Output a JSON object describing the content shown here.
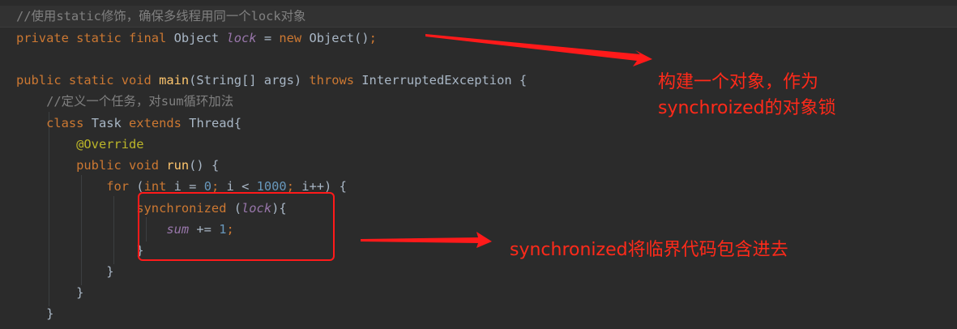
{
  "editor": {
    "lines": [
      {
        "id": "comment-static",
        "tokens": [
          {
            "text": "//使用static修饰，确保多线程用同一个lock对象",
            "kind": "cmt"
          }
        ]
      },
      {
        "id": "lock-declaration",
        "tokens": [
          {
            "text": "private static final ",
            "kind": "kw"
          },
          {
            "text": "Object ",
            "kind": "plain"
          },
          {
            "text": "lock",
            "kind": "field"
          },
          {
            "text": " = ",
            "kind": "plain"
          },
          {
            "text": "new ",
            "kind": "kw"
          },
          {
            "text": "Object()",
            "kind": "plain"
          },
          {
            "text": ";",
            "kind": "kw"
          }
        ]
      },
      {
        "id": "blank-line",
        "tokens": []
      },
      {
        "id": "main-signature",
        "tokens": [
          {
            "text": "public static void ",
            "kind": "kw"
          },
          {
            "text": "main",
            "kind": "fn"
          },
          {
            "text": "(String[] args) ",
            "kind": "plain"
          },
          {
            "text": "throws ",
            "kind": "kw"
          },
          {
            "text": "InterruptedException {",
            "kind": "plain"
          }
        ]
      },
      {
        "id": "comment-task",
        "tokens": [
          {
            "text": "    //定义一个任务，对sum循环加法",
            "kind": "cmt"
          }
        ]
      },
      {
        "id": "class-task",
        "tokens": [
          {
            "text": "    ",
            "kind": "plain"
          },
          {
            "text": "class ",
            "kind": "kw"
          },
          {
            "text": "Task ",
            "kind": "plain"
          },
          {
            "text": "extends ",
            "kind": "kw"
          },
          {
            "text": "Thread{",
            "kind": "plain"
          }
        ]
      },
      {
        "id": "override-annotation",
        "tokens": [
          {
            "text": "        ",
            "kind": "plain"
          },
          {
            "text": "@Override",
            "kind": "ann"
          }
        ]
      },
      {
        "id": "run-signature",
        "tokens": [
          {
            "text": "        ",
            "kind": "plain"
          },
          {
            "text": "public void ",
            "kind": "kw"
          },
          {
            "text": "run",
            "kind": "fn"
          },
          {
            "text": "() {",
            "kind": "plain"
          }
        ]
      },
      {
        "id": "for-loop",
        "tokens": [
          {
            "text": "            ",
            "kind": "plain"
          },
          {
            "text": "for ",
            "kind": "kw"
          },
          {
            "text": "(",
            "kind": "plain"
          },
          {
            "text": "int ",
            "kind": "kw"
          },
          {
            "text": "i = ",
            "kind": "plain"
          },
          {
            "text": "0",
            "kind": "num"
          },
          {
            "text": "; ",
            "kind": "kw"
          },
          {
            "text": "i < ",
            "kind": "plain"
          },
          {
            "text": "1000",
            "kind": "num"
          },
          {
            "text": "; ",
            "kind": "kw"
          },
          {
            "text": "i++) {",
            "kind": "plain"
          }
        ]
      },
      {
        "id": "synchronized-block",
        "tokens": [
          {
            "text": "                ",
            "kind": "plain"
          },
          {
            "text": "synchronized ",
            "kind": "kw"
          },
          {
            "text": "(",
            "kind": "plain"
          },
          {
            "text": "lock",
            "kind": "field"
          },
          {
            "text": "){",
            "kind": "plain"
          }
        ]
      },
      {
        "id": "sum-increment",
        "tokens": [
          {
            "text": "                    ",
            "kind": "plain"
          },
          {
            "text": "sum",
            "kind": "field"
          },
          {
            "text": " += ",
            "kind": "plain"
          },
          {
            "text": "1",
            "kind": "num"
          },
          {
            "text": ";",
            "kind": "kw"
          }
        ]
      },
      {
        "id": "close-sync",
        "tokens": [
          {
            "text": "                }",
            "kind": "plain"
          }
        ]
      },
      {
        "id": "close-for",
        "tokens": [
          {
            "text": "            }",
            "kind": "plain"
          }
        ]
      },
      {
        "id": "close-run",
        "tokens": [
          {
            "text": "        }",
            "kind": "plain"
          }
        ]
      },
      {
        "id": "close-class",
        "tokens": [
          {
            "text": "    }",
            "kind": "plain"
          }
        ]
      }
    ]
  },
  "annotations": {
    "lock_note_line1": "构建一个对象，作为",
    "lock_note_line2": "synchroized的对象锁",
    "sync_note": "synchronized将临界代码包含进去"
  },
  "colors": {
    "background": "#2b2b2b",
    "keyword": "#cc7832",
    "plain": "#a9b7c6",
    "method": "#ffc66d",
    "field": "#9876aa",
    "number": "#6897bb",
    "annotation": "#bbb529",
    "comment": "#808080",
    "markup_red": "#ff1a1a"
  }
}
